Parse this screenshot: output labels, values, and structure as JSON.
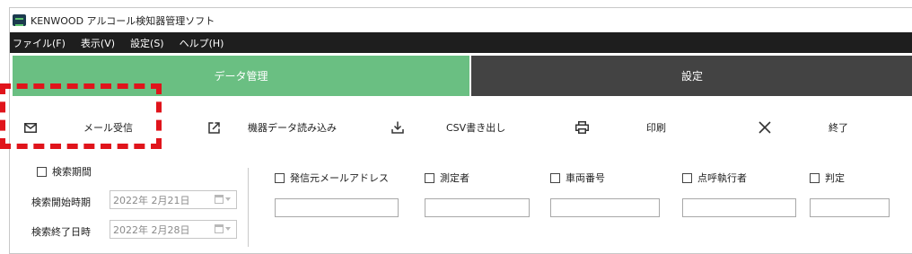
{
  "window": {
    "title": "KENWOOD アルコール検知器管理ソフト",
    "app_icon": "kenwood-app-icon"
  },
  "menu": [
    "ファイル(F)",
    "表示(V)",
    "設定(S)",
    "ヘルプ(H)"
  ],
  "tabs": {
    "data_management": "データ管理",
    "settings": "設定"
  },
  "toolbar": {
    "mail_receive": {
      "label": "メール受信",
      "icon": "envelope-icon"
    },
    "device_import": {
      "label": "機器データ読み込み",
      "icon": "external-link-icon"
    },
    "csv_export": {
      "label": "CSV書き出し",
      "icon": "download-icon"
    },
    "print": {
      "label": "印刷",
      "icon": "printer-icon"
    },
    "exit": {
      "label": "終了",
      "icon": "close-x-icon"
    }
  },
  "search": {
    "period_checkbox_label": "検索期間",
    "start_label": "検索開始時期",
    "start_value": "2022年  2月21日",
    "end_label": "検索終了日時",
    "end_value": "2022年  2月28日",
    "filters": {
      "sender_mail": "発信元メールアドレス",
      "measurer": "測定者",
      "vehicle_number": "車両番号",
      "roll_call_executor": "点呼執行者",
      "judgment": "判定"
    }
  },
  "colors": {
    "tab_active": "#6abf82",
    "tab_inactive": "#434343",
    "menubar": "#1e1e1e",
    "highlight": "#e0141b"
  }
}
